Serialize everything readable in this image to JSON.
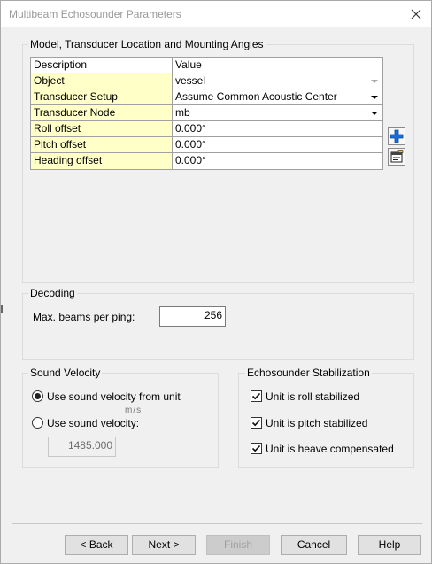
{
  "window": {
    "title": "Multibeam Echosounder Parameters",
    "close_icon": "close-icon"
  },
  "model_group": {
    "label": "Model, Transducer Location and Mounting Angles",
    "grid": {
      "headers": [
        "Description",
        "Value"
      ],
      "rows": [
        {
          "desc": "Object",
          "value": "vessel",
          "dropdown": true,
          "disabled": true
        },
        {
          "desc": "Transducer Setup",
          "value": "Assume Common Acoustic Center",
          "dropdown": true
        },
        {
          "desc": "Transducer Node",
          "value": "mb",
          "dropdown": true
        },
        {
          "desc": "Roll offset",
          "value": "0.000°"
        },
        {
          "desc": "Pitch offset",
          "value": "0.000°"
        },
        {
          "desc": "Heading offset",
          "value": "0.000°"
        }
      ]
    },
    "side_buttons": [
      "add-icon",
      "properties-icon"
    ]
  },
  "decoding": {
    "label": "Decoding",
    "max_beams_label": "Max.  beams per ping:",
    "max_beams_value": "256"
  },
  "sound_velocity": {
    "label": "Sound Velocity",
    "option_from_unit": "Use sound velocity from unit",
    "option_fixed": "Use sound velocity:",
    "unit": "m/s",
    "value": "1485.000",
    "selected": "from_unit"
  },
  "stabilization": {
    "label": "Echosounder Stabilization",
    "roll": "Unit is roll stabilized",
    "pitch": "Unit is pitch stabilized",
    "heave": "Unit is heave compensated",
    "roll_checked": true,
    "pitch_checked": true,
    "heave_checked": true
  },
  "footer": {
    "back": "< Back",
    "next": "Next >",
    "finish": "Finish",
    "cancel": "Cancel",
    "help": "Help"
  },
  "colors": {
    "grid_highlight": "#ffffc8",
    "add_icon": "#1a6fd6"
  }
}
